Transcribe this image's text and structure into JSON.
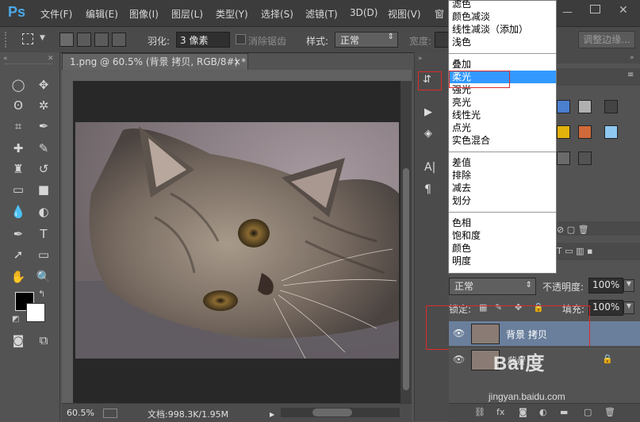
{
  "app": {
    "logo": "Ps"
  },
  "menubar": {
    "items": [
      "文件(F)",
      "编辑(E)",
      "图像(I)",
      "图层(L)",
      "类型(Y)",
      "选择(S)",
      "滤镜(T)",
      "3D(D)",
      "视图(V)",
      "窗"
    ]
  },
  "options": {
    "feather_label": "羽化:",
    "feather_value": "3 像素",
    "antialias_label": "消除锯齿",
    "style_label": "样式:",
    "style_value": "正常",
    "width_label": "宽度:",
    "refine_label": "调整边缘..."
  },
  "document": {
    "tab_title": "1.png @ 60.5% (背景 拷贝, RGB/8#) *",
    "close": "×",
    "zoom": "60.5%",
    "doc_info": "文档:998.3K/1.95M"
  },
  "blend_menu": {
    "group1": [
      "滤色",
      "颜色减淡",
      "线性减淡（添加）",
      "浅色"
    ],
    "group2": [
      "叠加",
      "柔光",
      "强光",
      "亮光",
      "线性光",
      "点光",
      "实色混合"
    ],
    "group3": [
      "差值",
      "排除",
      "减去",
      "划分"
    ],
    "group4": [
      "色相",
      "饱和度",
      "颜色",
      "明度"
    ],
    "selected": "柔光"
  },
  "layers": {
    "blend_mode": "正常",
    "opacity_label": "不透明度:",
    "opacity_value": "100%",
    "lock_label": "锁定:",
    "fill_label": "填充:",
    "fill_value": "100%",
    "items": [
      {
        "name": "背景 拷贝",
        "selected": true
      },
      {
        "name": "背景",
        "selected": false
      }
    ]
  },
  "watermark": {
    "text": "Bai度",
    "sub": "jingyan.baidu.com"
  },
  "colors": {
    "selection": "#3399ff",
    "highlight_box": "#e02a2a",
    "layer_selected": "#6a7f9c"
  }
}
